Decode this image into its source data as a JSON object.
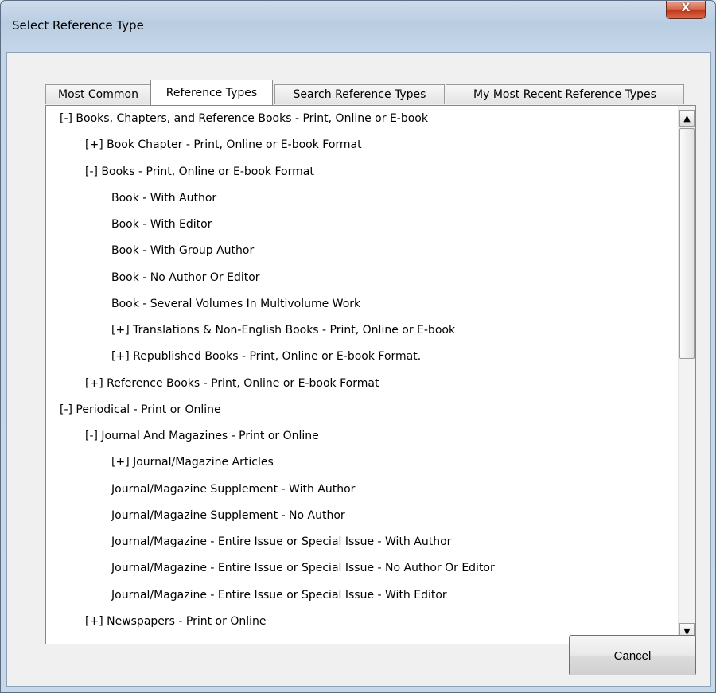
{
  "window": {
    "title": "Select Reference Type",
    "close_label": "X"
  },
  "tabs": [
    {
      "label": "Most Common"
    },
    {
      "label": "Reference Types",
      "active": true
    },
    {
      "label": "Search Reference Types"
    },
    {
      "label": "My Most Recent Reference Types"
    }
  ],
  "list": {
    "items": [
      {
        "label": "[-] Books, Chapters, and Reference Books - Print, Online or E-book"
      },
      {
        "label": "[+] Book Chapter - Print, Online or E-book Format"
      },
      {
        "label": "[-] Books - Print, Online or E-book Format"
      },
      {
        "label": "Book - With Author"
      },
      {
        "label": "Book - With Editor"
      },
      {
        "label": "Book - With Group Author"
      },
      {
        "label": "Book - No Author Or Editor"
      },
      {
        "label": "Book - Several Volumes In Multivolume Work"
      },
      {
        "label": "[+] Translations & Non-English Books - Print, Online or E-book"
      },
      {
        "label": "[+] Republished Books - Print, Online or E-book Format."
      },
      {
        "label": "[+] Reference Books - Print, Online or E-book Format"
      },
      {
        "label": "[-] Periodical - Print or Online"
      },
      {
        "label": "[-] Journal And Magazines - Print or Online"
      },
      {
        "label": "[+] Journal/Magazine Articles"
      },
      {
        "label": "Journal/Magazine Supplement - With Author"
      },
      {
        "label": "Journal/Magazine Supplement - No Author"
      },
      {
        "label": "Journal/Magazine - Entire Issue or Special Issue - With Author"
      },
      {
        "label": "Journal/Magazine - Entire Issue or Special Issue - No Author Or Editor"
      },
      {
        "label": "Journal/Magazine - Entire Issue  or Special Issue - With Editor"
      },
      {
        "label": "[+] Newspapers - Print or Online"
      }
    ],
    "scroll_up_glyph": "▲",
    "scroll_down_glyph": "▼"
  },
  "buttons": {
    "cancel_label": "Cancel"
  }
}
